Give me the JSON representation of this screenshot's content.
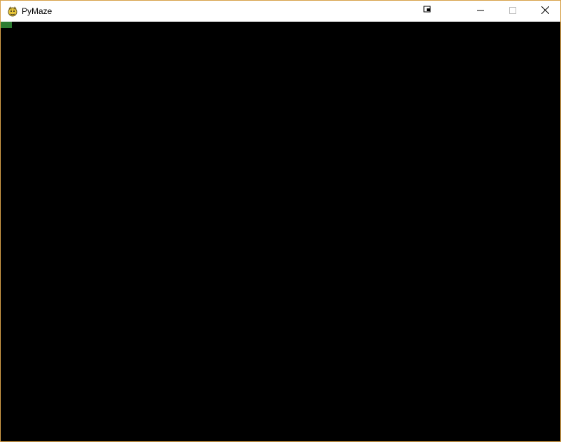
{
  "window": {
    "title": "PyMaze",
    "icon": "pygame-snake-icon",
    "controls": [
      "compact-overlay-icon",
      "minimize-icon",
      "maximize-icon",
      "close-icon"
    ]
  },
  "colors": {
    "border": "#d8a24a",
    "titlebar": "#ffffff",
    "background": "#000000",
    "player": "#2e7d32"
  }
}
